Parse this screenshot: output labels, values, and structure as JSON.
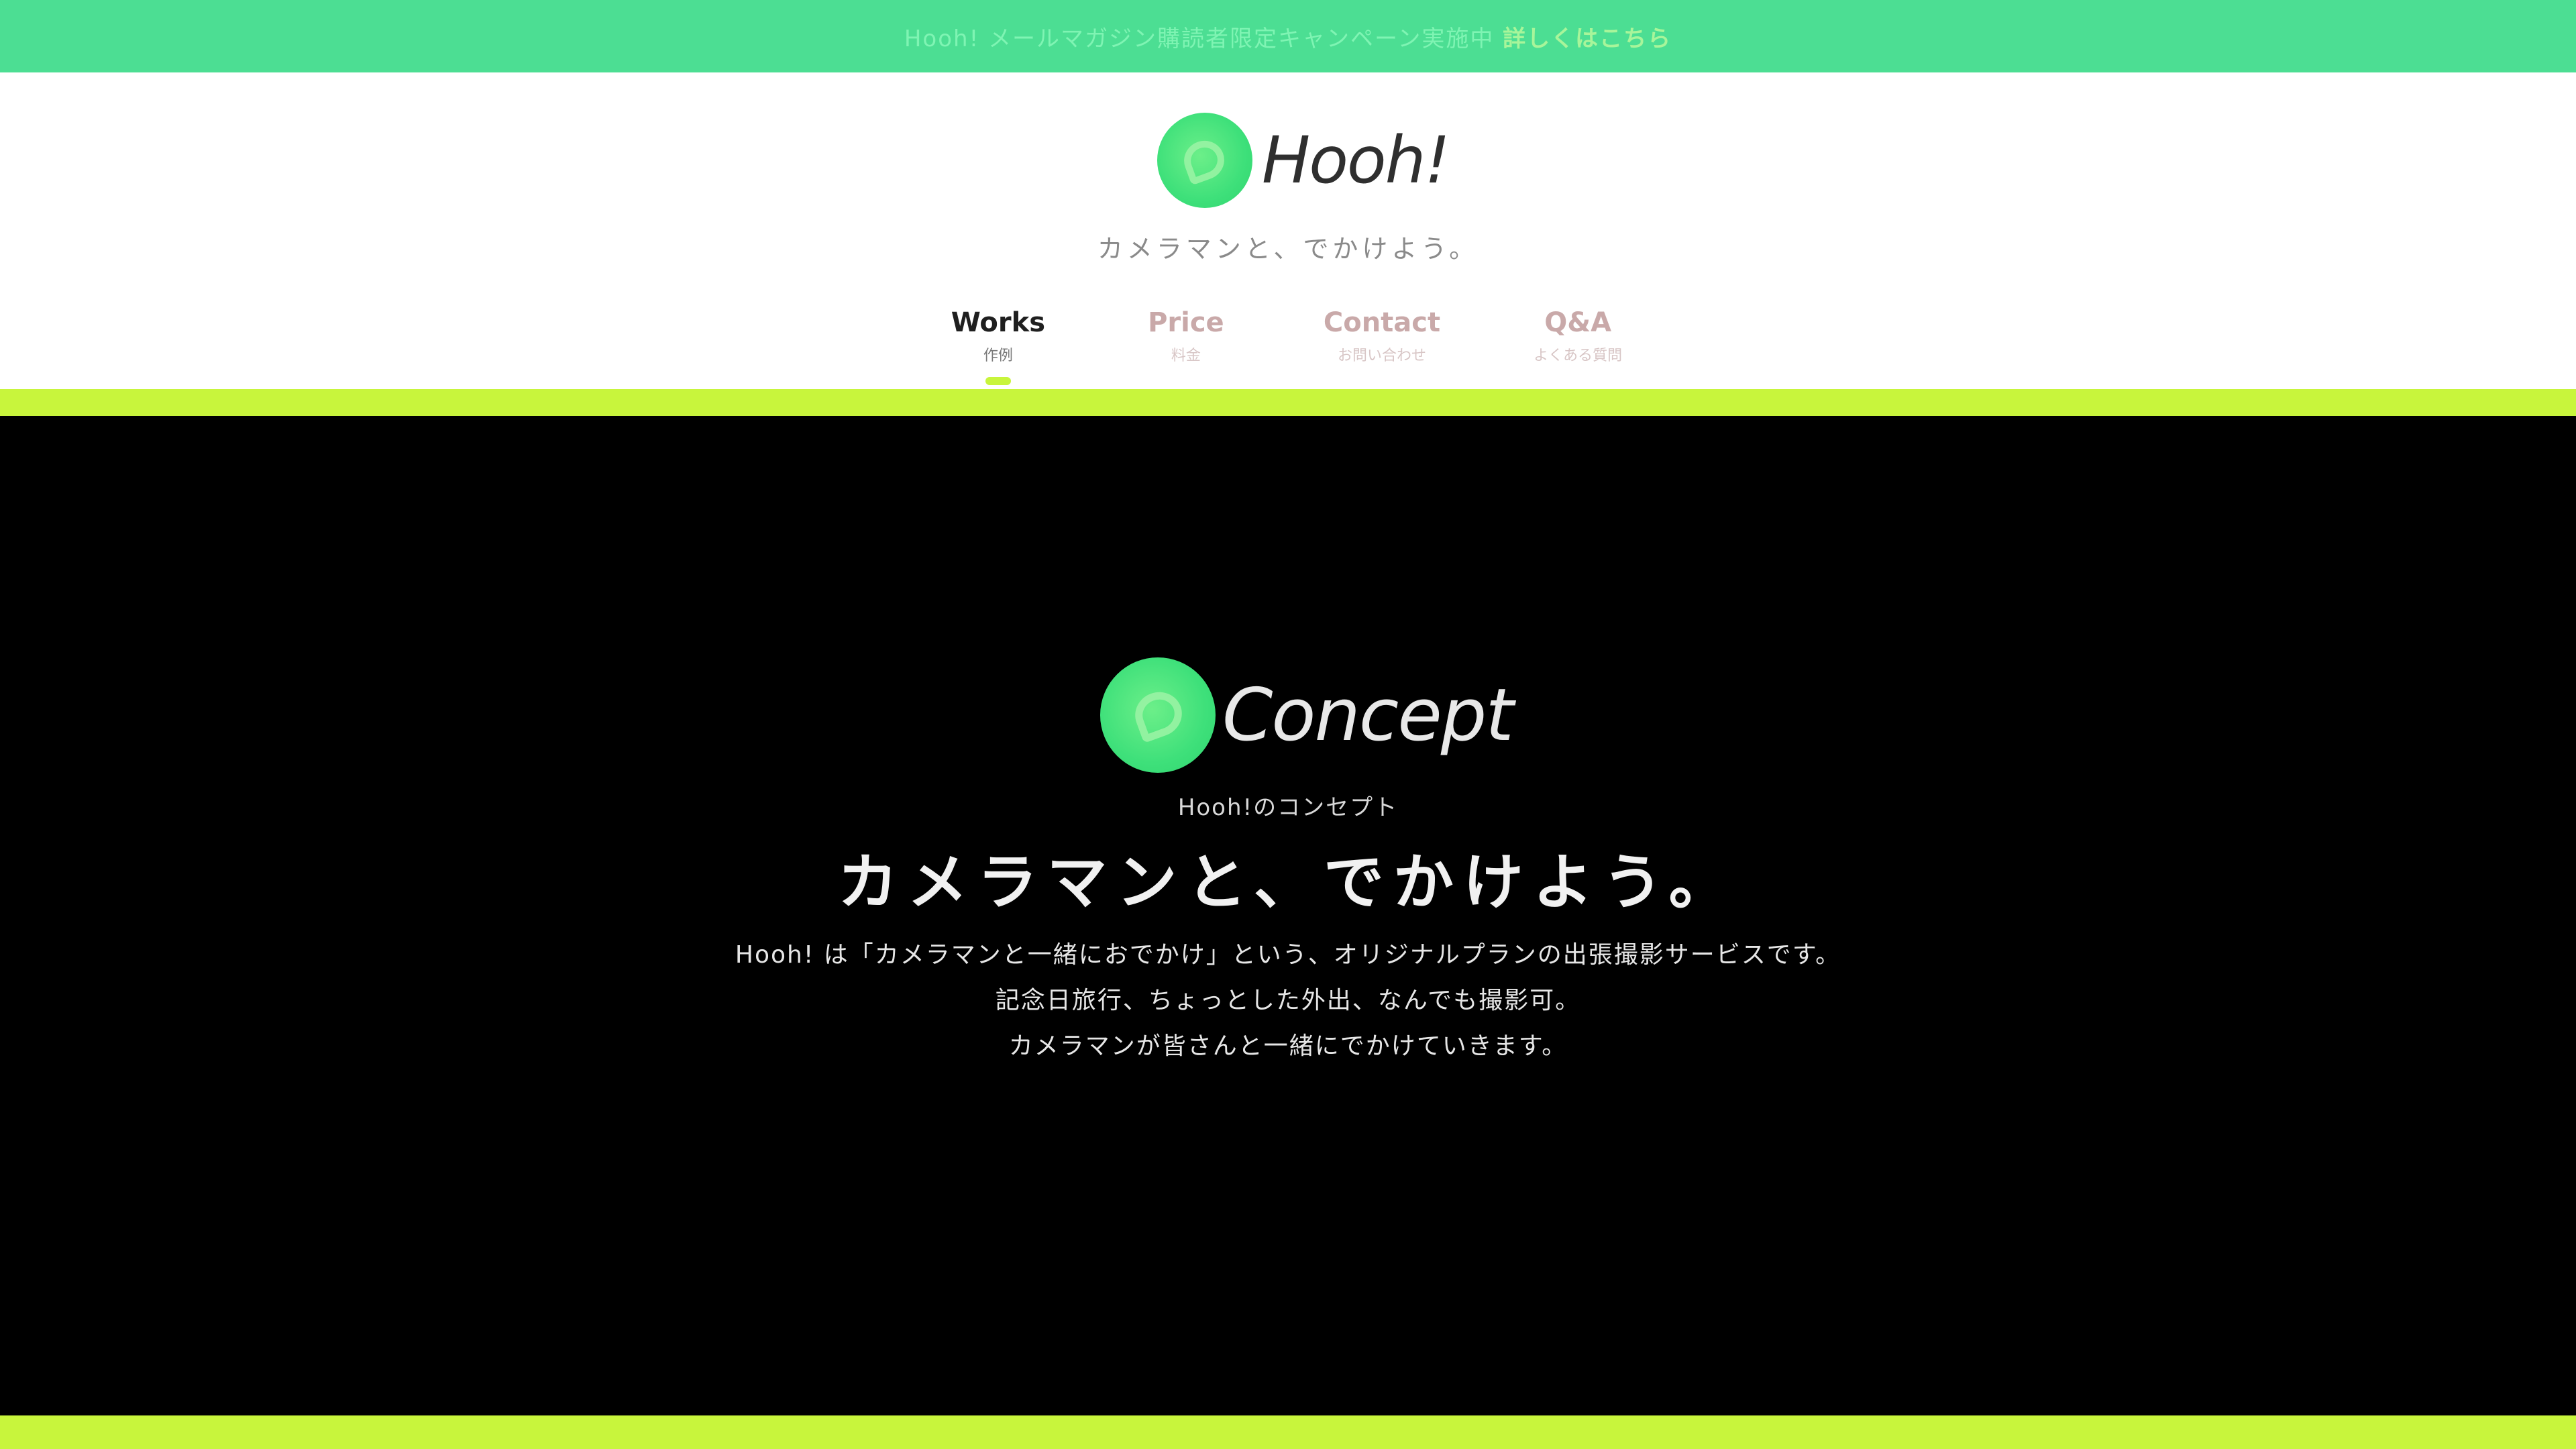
{
  "top_bar": {
    "text": "Hooh! メールマガジン購読者限定キャンペーン実施中",
    "highlight": "詳しくはこちら"
  },
  "header": {
    "logo_text": "Hooh!",
    "tagline": "カメラマンと、でかけよう。",
    "nav": [
      {
        "en": "Works",
        "ja": "作例"
      },
      {
        "en": "Price",
        "ja": "料金"
      },
      {
        "en": "Contact",
        "ja": "お問い合わせ"
      },
      {
        "en": "Q&A",
        "ja": "よくある質問"
      }
    ]
  },
  "concept": {
    "title": "Concept",
    "subtitle": "Hooh!のコンセプト",
    "catch": "カメラマンと、でかけよう。",
    "body": [
      "Hooh! は「カメラマンと一緒におでかけ」という、オリジナルプランの出張撮影サービスです。",
      "記念日旅行、ちょっとした外出、なんでも撮影可。",
      "カメラマンが皆さんと一緒にでかけていきます。"
    ]
  },
  "colors": {
    "brand_green": "#4cde93",
    "accent_lime": "#c8f53c",
    "concept_bg": "#000000"
  }
}
